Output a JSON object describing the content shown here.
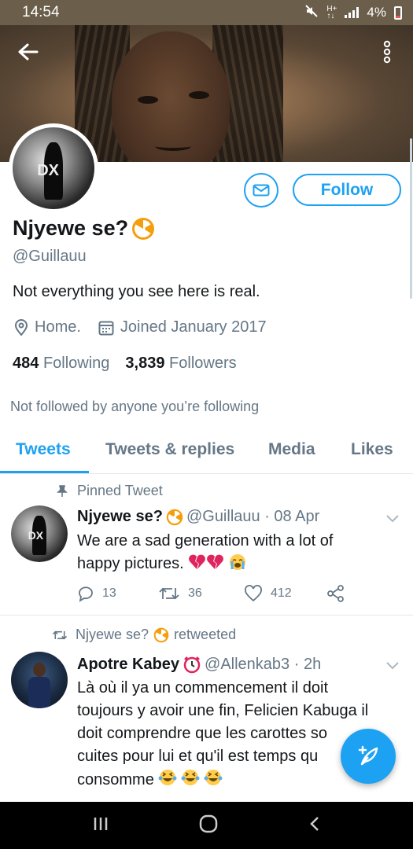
{
  "status_bar": {
    "time": "14:54",
    "battery": "4%"
  },
  "profile": {
    "name": "Njyewe se?",
    "handle": "@Guillauu",
    "bio": "Not everything you see here is real.",
    "location": "Home.",
    "joined": "Joined January 2017",
    "following_count": "484",
    "following_label": "Following",
    "followers_count": "3,839",
    "followers_label": "Followers",
    "follow_label": "Follow",
    "not_followed": "Not followed by anyone you’re following"
  },
  "tabs": [
    {
      "label": "Tweets",
      "active": true
    },
    {
      "label": "Tweets & replies",
      "active": false
    },
    {
      "label": "Media",
      "active": false
    },
    {
      "label": "Likes",
      "active": false
    }
  ],
  "tweets": [
    {
      "context": "Pinned Tweet",
      "name": "Njyewe se?",
      "handle_date": "@Guillauu · 08 Apr",
      "text": "We are a sad generation with a lot of happy pictures.",
      "replies": "13",
      "retweets": "36",
      "likes": "412"
    },
    {
      "context": "Njyewe se? retweeted",
      "context_name": "Njyewe se?",
      "context_suffix": "retweeted",
      "name": "Apotre Kabey",
      "handle_date": "@Allenkab3 · 2h",
      "text_lines": [
        "Là où il ya un commencement il doit",
        "toujours y avoir une fin, Felicien Kabuga il",
        "doit comprendre que les carottes so",
        "cuites pour lui et qu'il est temps qu",
        "consomme"
      ]
    }
  ],
  "colors": {
    "accent": "#1da1f2",
    "muted": "#657786",
    "text": "#14171a"
  }
}
